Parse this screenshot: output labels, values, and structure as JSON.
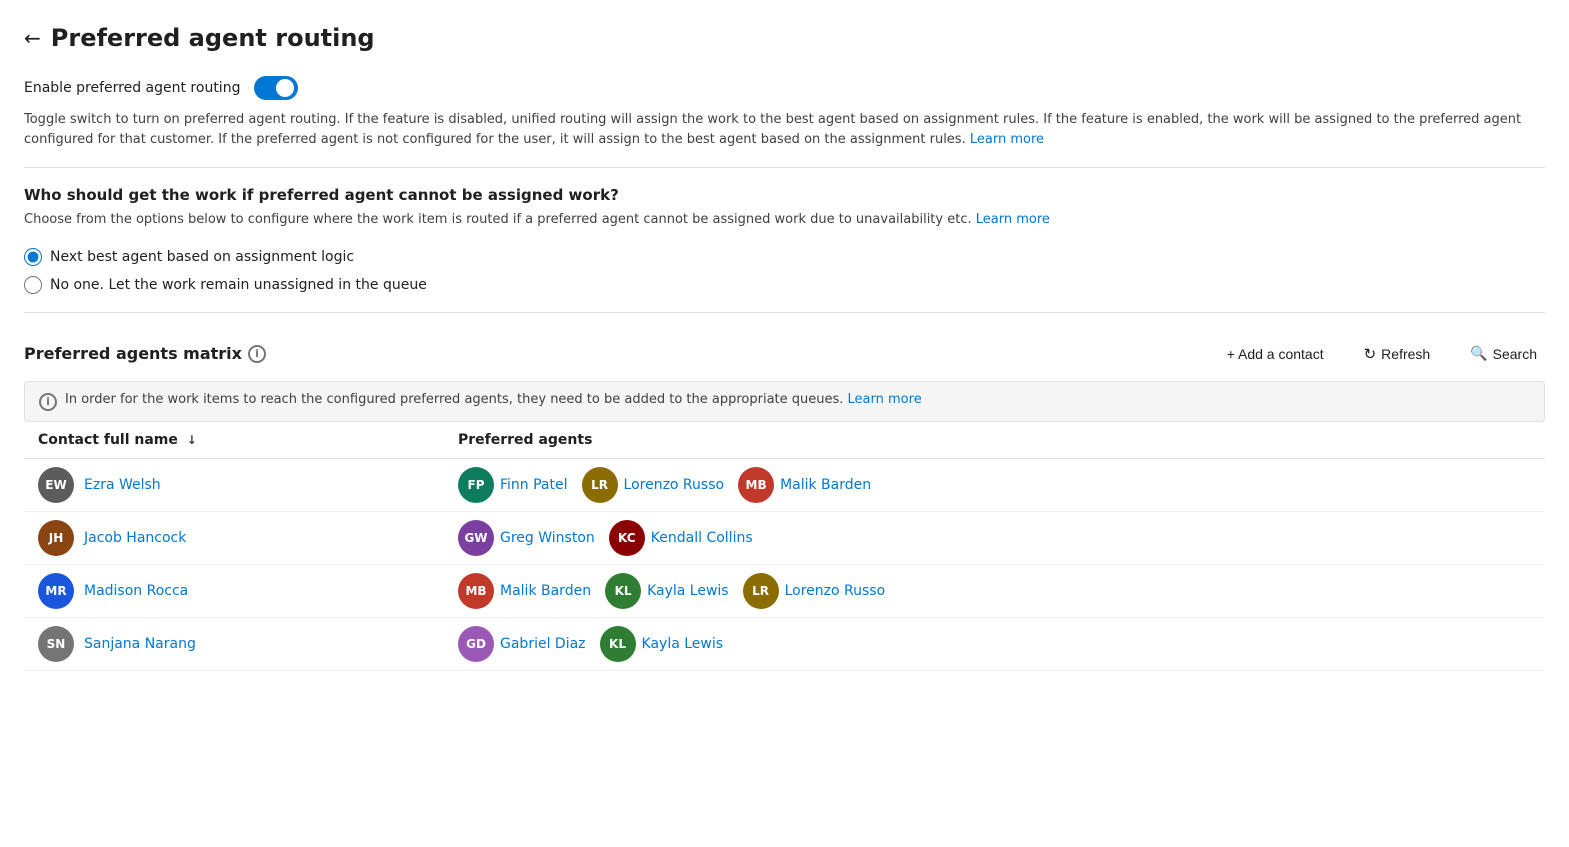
{
  "page": {
    "back_label": "←",
    "title": "Preferred agent routing"
  },
  "enable_section": {
    "label": "Enable preferred agent routing",
    "toggle_on": true,
    "description": "Toggle switch to turn on preferred agent routing. If the feature is disabled, unified routing will assign the work to the best agent based on assignment rules. If the feature is enabled, the work will be assigned to the preferred agent configured for that customer. If the preferred agent is not configured for the user, it will assign to the best agent based on the assignment rules.",
    "learn_more_label": "Learn more"
  },
  "fallback_section": {
    "heading": "Who should get the work if preferred agent cannot be assigned work?",
    "description": "Choose from the options below to configure where the work item is routed if a preferred agent cannot be assigned work due to unavailability etc.",
    "learn_more_label": "Learn more",
    "options": [
      {
        "id": "next_best",
        "label": "Next best agent based on assignment logic",
        "checked": true
      },
      {
        "id": "no_one",
        "label": "No one. Let the work remain unassigned in the queue",
        "checked": false
      }
    ]
  },
  "matrix_section": {
    "title": "Preferred agents matrix",
    "info_icon_label": "i",
    "add_contact_label": "+ Add a contact",
    "refresh_label": "Refresh",
    "search_label": "Search",
    "banner_text": "In order for the work items to reach the configured preferred agents, they need to be added to the appropriate queues.",
    "banner_learn_more": "Learn more",
    "columns": [
      {
        "label": "Contact full name",
        "sortable": true
      },
      {
        "label": "Preferred agents",
        "sortable": false
      }
    ],
    "rows": [
      {
        "contact": {
          "name": "Ezra Welsh",
          "initials": "EW",
          "color": "#5c5c5c"
        },
        "agents": [
          {
            "name": "Finn Patel",
            "initials": "FP",
            "color": "#0e7d5e"
          },
          {
            "name": "Lorenzo Russo",
            "initials": "LR",
            "color": "#8a6c00"
          },
          {
            "name": "Malik Barden",
            "initials": "MB",
            "color": "#c0392b"
          }
        ]
      },
      {
        "contact": {
          "name": "Jacob Hancock",
          "initials": "JH",
          "color": "#8b4513"
        },
        "agents": [
          {
            "name": "Greg Winston",
            "initials": "GW",
            "color": "#7b3fa0"
          },
          {
            "name": "Kendall Collins",
            "initials": "KC",
            "color": "#8b0000"
          }
        ]
      },
      {
        "contact": {
          "name": "Madison Rocca",
          "initials": "MR",
          "color": "#1a56db"
        },
        "agents": [
          {
            "name": "Malik Barden",
            "initials": "MB",
            "color": "#c0392b"
          },
          {
            "name": "Kayla Lewis",
            "initials": "KL",
            "color": "#2e7d32"
          },
          {
            "name": "Lorenzo Russo",
            "initials": "LR",
            "color": "#8a6c00"
          }
        ]
      },
      {
        "contact": {
          "name": "Sanjana Narang",
          "initials": "SN",
          "color": "#757575"
        },
        "agents": [
          {
            "name": "Gabriel Diaz",
            "initials": "GD",
            "color": "#9b59b6"
          },
          {
            "name": "Kayla Lewis",
            "initials": "KL",
            "color": "#2e7d32"
          }
        ]
      }
    ]
  }
}
